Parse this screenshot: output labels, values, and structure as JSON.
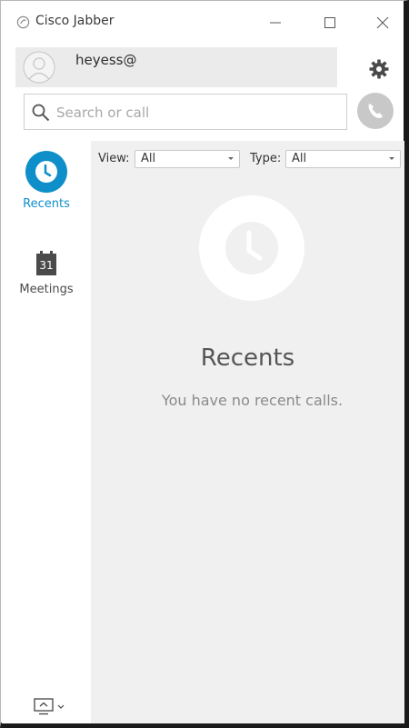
{
  "window": {
    "title": "Cisco Jabber",
    "controls": [
      "minimize",
      "maximize",
      "close"
    ]
  },
  "profile": {
    "username": "heyess@",
    "avatar_icon": "default-user-avatar-icon"
  },
  "search": {
    "placeholder": "Search or call",
    "value": ""
  },
  "nav": {
    "items": [
      {
        "label": "Recents",
        "icon": "clock-icon",
        "active": true
      },
      {
        "label": "Meetings",
        "icon": "calendar-icon",
        "calendar_day": "31",
        "active": false
      }
    ]
  },
  "filters": {
    "view_label": "View:",
    "view_value": "All",
    "type_label": "Type:",
    "type_value": "All"
  },
  "empty_state": {
    "title": "Recents",
    "message": "You have no recent calls."
  },
  "colors": {
    "accent": "#0e8fc9",
    "panel_bg": "#f0f0f0",
    "call_button": "#c8c8c8"
  }
}
